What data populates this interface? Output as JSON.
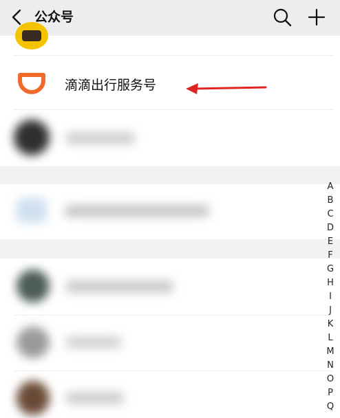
{
  "header": {
    "title": "公众号",
    "back_icon": "chevron-left-icon",
    "search_icon": "search-icon",
    "add_icon": "plus-icon"
  },
  "accounts": {
    "didi": {
      "name": "滴滴出行服务号",
      "brand_color": "#f06b2a"
    }
  },
  "index_letters": [
    "A",
    "B",
    "C",
    "D",
    "E",
    "F",
    "G",
    "H",
    "I",
    "J",
    "K",
    "L",
    "M",
    "N",
    "O",
    "P",
    "Q"
  ],
  "annotation": {
    "arrow_color": "#e02424"
  }
}
